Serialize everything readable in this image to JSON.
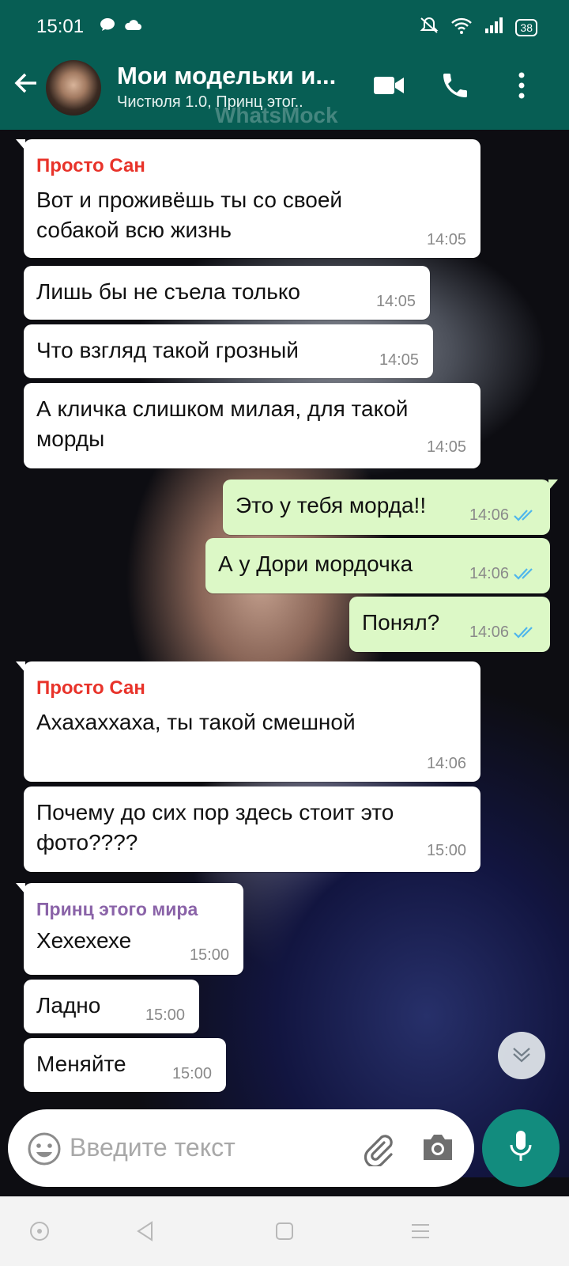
{
  "status_bar": {
    "time": "15:01",
    "battery": "38",
    "icons": [
      "chat-bubble-icon",
      "cloud-icon",
      "mute-icon",
      "wifi-icon",
      "signal-icon",
      "battery-icon"
    ]
  },
  "header": {
    "title": "Мои модельки и...",
    "subtitle": "Чистюля 1.0, Принц этог..",
    "watermark": "WhatsMock"
  },
  "messages": [
    {
      "dir": "in",
      "sender": "Просто Сан",
      "sender_color": "#e8332a",
      "lines": [
        "Вот и проживёшь ты со своей",
        "собакой всю жизнь"
      ],
      "time": "14:05"
    },
    {
      "dir": "in",
      "lines": [
        "Лишь бы не съела только"
      ],
      "time": "14:05"
    },
    {
      "dir": "in",
      "lines": [
        "Что взгляд такой грозный"
      ],
      "time": "14:05"
    },
    {
      "dir": "in",
      "lines": [
        "А кличка слишком милая, для такой",
        "морды"
      ],
      "time": "14:05"
    },
    {
      "dir": "out",
      "lines": [
        "Это у тебя морда!!"
      ],
      "time": "14:06",
      "status": "read"
    },
    {
      "dir": "out",
      "lines": [
        "А у Дори мордочка"
      ],
      "time": "14:06",
      "status": "read"
    },
    {
      "dir": "out",
      "lines": [
        "Понял?"
      ],
      "time": "14:06",
      "status": "read"
    },
    {
      "dir": "in",
      "sender": "Просто Сан",
      "sender_color": "#e8332a",
      "lines": [
        "Ахахаххаха, ты такой смешной"
      ],
      "time": "14:06"
    },
    {
      "dir": "in",
      "lines": [
        "Почему до сих пор здесь стоит это",
        "фото????"
      ],
      "time": "15:00"
    },
    {
      "dir": "in",
      "sender": "Принц этого мира",
      "sender_color": "#8a63a8",
      "lines": [
        "Хехехехе"
      ],
      "time": "15:00"
    },
    {
      "dir": "in",
      "lines": [
        "Ладно"
      ],
      "time": "15:00"
    },
    {
      "dir": "in",
      "lines": [
        "Меняйте"
      ],
      "time": "15:00"
    }
  ],
  "composer": {
    "placeholder": "Введите текст"
  },
  "colors": {
    "header": "#075e54",
    "outgoing_bubble": "#dcf8c6",
    "incoming_bubble": "#ffffff",
    "read_ticks": "#4fb6ec",
    "mic_button": "#128c7e"
  }
}
